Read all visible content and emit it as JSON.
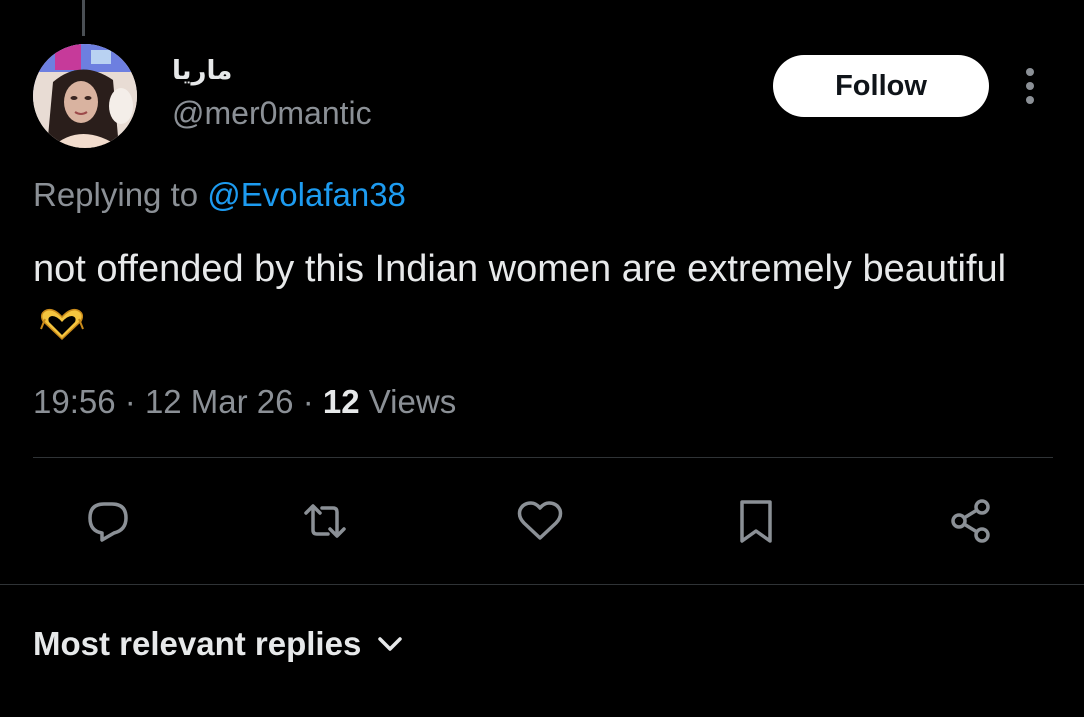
{
  "tweet": {
    "author": {
      "display_name": "ماريا",
      "handle": "@mer0mantic"
    },
    "follow_label": "Follow",
    "reply_prefix": "Replying to",
    "reply_mention": "@Evolafan38",
    "text": "not offended by this Indian women are extremely beautiful",
    "emoji": "heart-hands",
    "time": "19:56",
    "date": "12 Mar 26",
    "separator": "·",
    "views_count": "12",
    "views_label": "Views"
  },
  "actions": {
    "reply_icon": "reply-icon",
    "retweet_icon": "retweet-icon",
    "like_icon": "heart-icon",
    "bookmark_icon": "bookmark-icon",
    "share_icon": "share-icon"
  },
  "replies": {
    "sort_label": "Most relevant replies"
  },
  "colors": {
    "background": "#000000",
    "text_primary": "#e7e9ea",
    "text_secondary": "#8b9096",
    "link": "#1d9bf0",
    "divider": "#2f3336",
    "icon": "#8b9096"
  }
}
